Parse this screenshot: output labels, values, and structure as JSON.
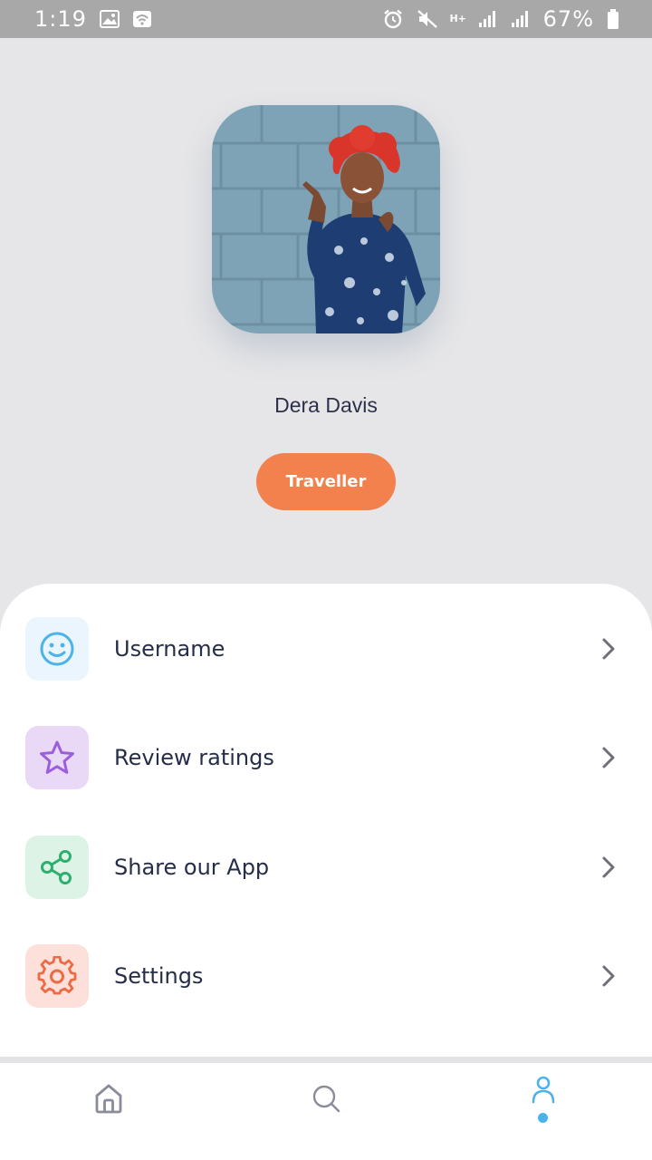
{
  "status_bar": {
    "time": "1:19",
    "network_type": "H+",
    "battery_percent": "67%"
  },
  "profile": {
    "name": "Dera Davis",
    "role": "Traveller"
  },
  "menu": {
    "items": [
      {
        "label": "Username",
        "icon": "smiley-icon",
        "color": "#4cb3ea",
        "bg": "#eaf5fd"
      },
      {
        "label": "Review ratings",
        "icon": "star-icon",
        "color": "#9b5fde",
        "bg": "#ead9f6"
      },
      {
        "label": "Share our App",
        "icon": "share-icon",
        "color": "#2fae6f",
        "bg": "#dcf3e6"
      },
      {
        "label": "Settings",
        "icon": "gear-icon",
        "color": "#ee6a44",
        "bg": "#fde0da"
      }
    ]
  },
  "bottom_nav": {
    "items": [
      {
        "name": "home",
        "icon": "home-icon",
        "active": false
      },
      {
        "name": "search",
        "icon": "search-icon",
        "active": false
      },
      {
        "name": "profile",
        "icon": "user-icon",
        "active": true
      }
    ],
    "active_color": "#4cb3ea",
    "inactive_color": "#8a8d99"
  },
  "colors": {
    "accent": "#f2814d",
    "background": "#e6e6e8",
    "text_primary": "#262d47"
  }
}
